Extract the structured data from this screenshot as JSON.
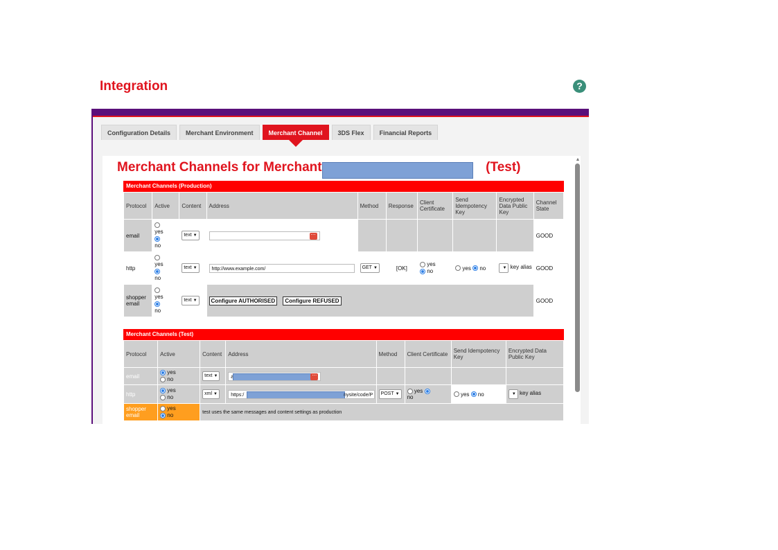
{
  "page": {
    "title": "Integration",
    "help_symbol": "?"
  },
  "tabs": [
    {
      "label": "Configuration Details",
      "active": false
    },
    {
      "label": "Merchant Environment",
      "active": false
    },
    {
      "label": "Merchant Channel",
      "active": true
    },
    {
      "label": "3DS Flex",
      "active": false
    },
    {
      "label": "Financial Reports",
      "active": false
    }
  ],
  "heading": {
    "prefix": "Merchant Channels for Merchant",
    "suffix": "(Test)"
  },
  "production": {
    "title": "Merchant Channels (Production)",
    "headers": [
      "Protocol",
      "Active",
      "Content",
      "Address",
      "Method",
      "Response",
      "Client Certificate",
      "Send Idempotency Key",
      "Encrypted Data Public Key",
      "Channel State"
    ],
    "rows": [
      {
        "protocol": "email",
        "yes": "yes",
        "no": "no",
        "content": "text",
        "address": "",
        "state": "GOOD"
      },
      {
        "protocol": "http",
        "yes": "yes",
        "no": "no",
        "content": "text",
        "address": "http://www.example.com/",
        "method": "GET",
        "response": "[OK]",
        "cert_yes": "yes",
        "cert_no": "no",
        "idem_yes": "yes",
        "idem_no": "no",
        "key": "key alias",
        "state": "GOOD"
      },
      {
        "protocol": "shopper email",
        "yes": "yes",
        "no": "no",
        "content": "text",
        "btn_authorised": "Configure AUTHORISED",
        "btn_refused": "Configure REFUSED",
        "state": "GOOD"
      }
    ]
  },
  "test": {
    "title": "Merchant Channels (Test)",
    "headers": [
      "Protocol",
      "Active",
      "Content",
      "Address",
      "Method",
      "Client Certificate",
      "Send Idempotency Key",
      "Encrypted Data Public Key"
    ],
    "rows": [
      {
        "protocol": "email",
        "yes": "yes",
        "no": "no",
        "content": "text",
        "address_prefix": "a"
      },
      {
        "protocol": "http",
        "yes": "yes",
        "no": "no",
        "content": "xml",
        "address_prefix": "https:/",
        "address_suffix": "nysite/code/P",
        "method": "POST",
        "cert_yes": "yes",
        "cert_no": "no",
        "idem_yes": "yes",
        "idem_no": "no",
        "key": "key alias"
      },
      {
        "protocol": "shopper email",
        "yes": "yes",
        "no": "no",
        "note": "test uses the same messages and content settings as production"
      }
    ]
  },
  "colors": {
    "accent": "#e0141e",
    "brand_bar": "#5a0f7a",
    "orange_row": "#ff9e1f",
    "yellow_row": "#f6d54d",
    "redaction": "#7ea1d6"
  }
}
